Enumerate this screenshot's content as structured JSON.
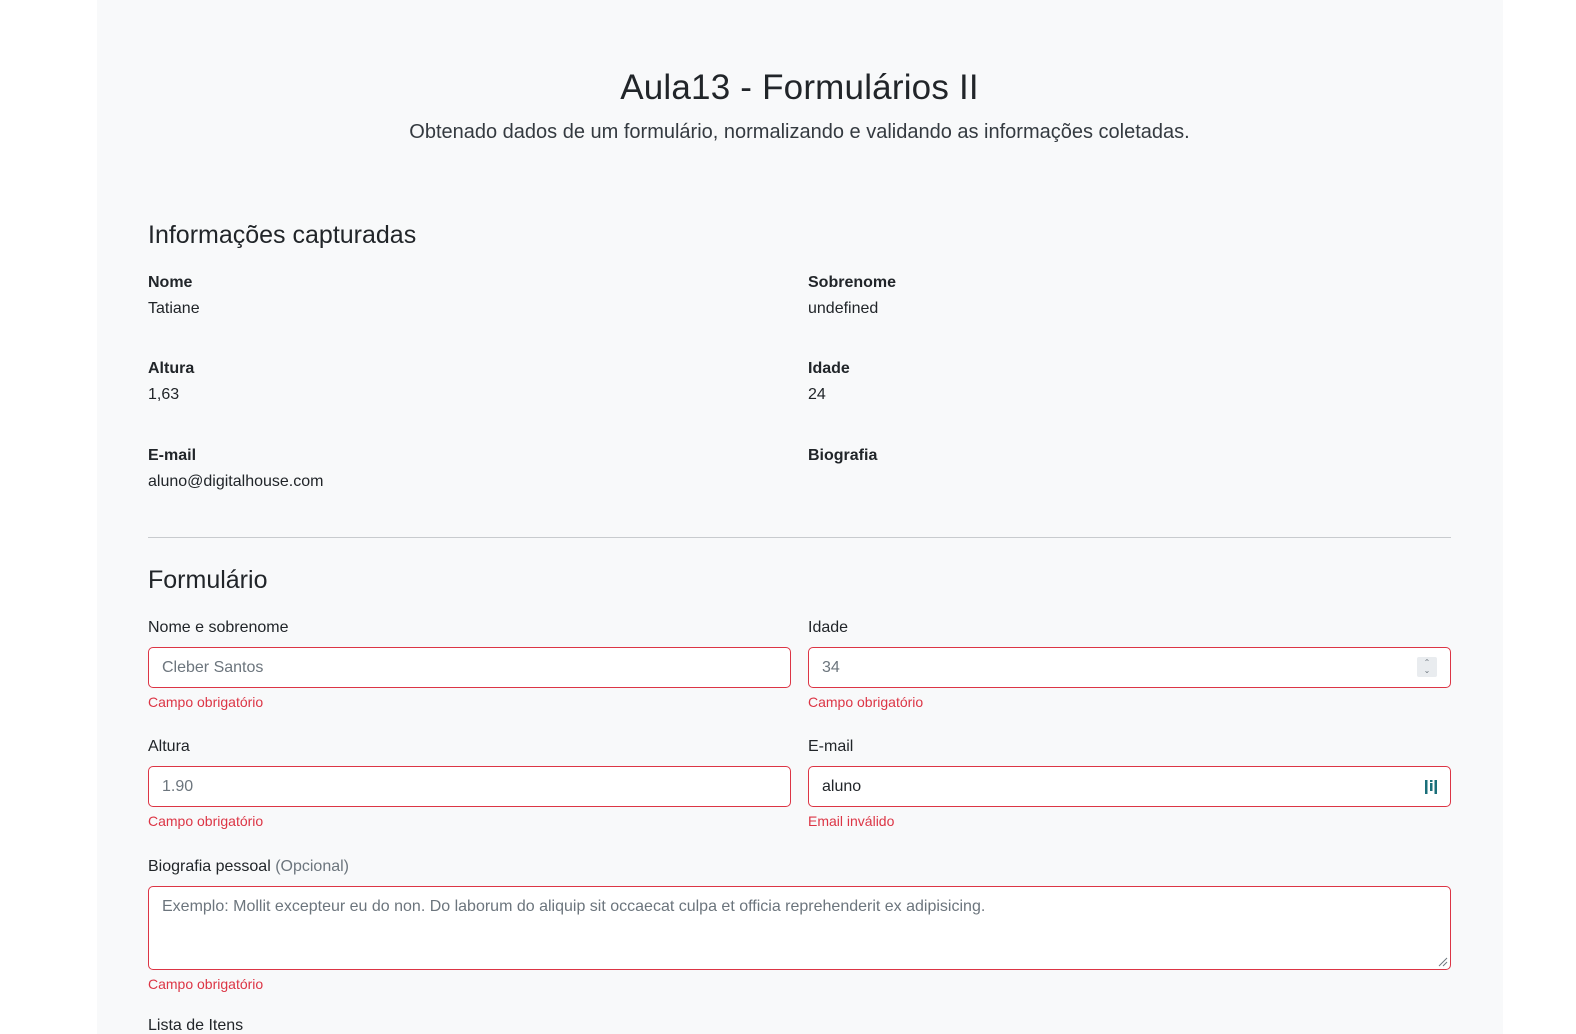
{
  "header": {
    "title": "Aula13 - Formulários II",
    "subtitle": "Obtenado dados de um formulário, normalizando e validando as informações coletadas."
  },
  "captured": {
    "section_title": "Informações capturadas",
    "items": [
      {
        "label": "Nome",
        "value": "Tatiane"
      },
      {
        "label": "Sobrenome",
        "value": "undefined"
      },
      {
        "label": "Altura",
        "value": "1,63"
      },
      {
        "label": "Idade",
        "value": "24"
      },
      {
        "label": "E-mail",
        "value": "aluno@digitalhouse.com"
      },
      {
        "label": "Biografia",
        "value": ""
      }
    ]
  },
  "form": {
    "section_title": "Formulário",
    "name": {
      "label": "Nome e sobrenome",
      "placeholder": "Cleber Santos",
      "error": "Campo obrigatório"
    },
    "age": {
      "label": "Idade",
      "placeholder": "34",
      "error": "Campo obrigatório"
    },
    "height": {
      "label": "Altura",
      "placeholder": "1.90",
      "error": "Campo obrigatório"
    },
    "email": {
      "label": "E-mail",
      "value": "aluno",
      "error": "Email inválido"
    },
    "bio": {
      "label": "Biografia pessoal",
      "optional": "(Opcional)",
      "placeholder": "Exemplo: Mollit excepteur eu do non. Do laborum do aliquip sit occaecat culpa et officia reprehenderit ex adipisicing.",
      "error": "Campo obrigatório"
    },
    "list_label": "Lista de Itens"
  },
  "colors": {
    "error": "#dc3545",
    "background": "#f8f9fa"
  }
}
